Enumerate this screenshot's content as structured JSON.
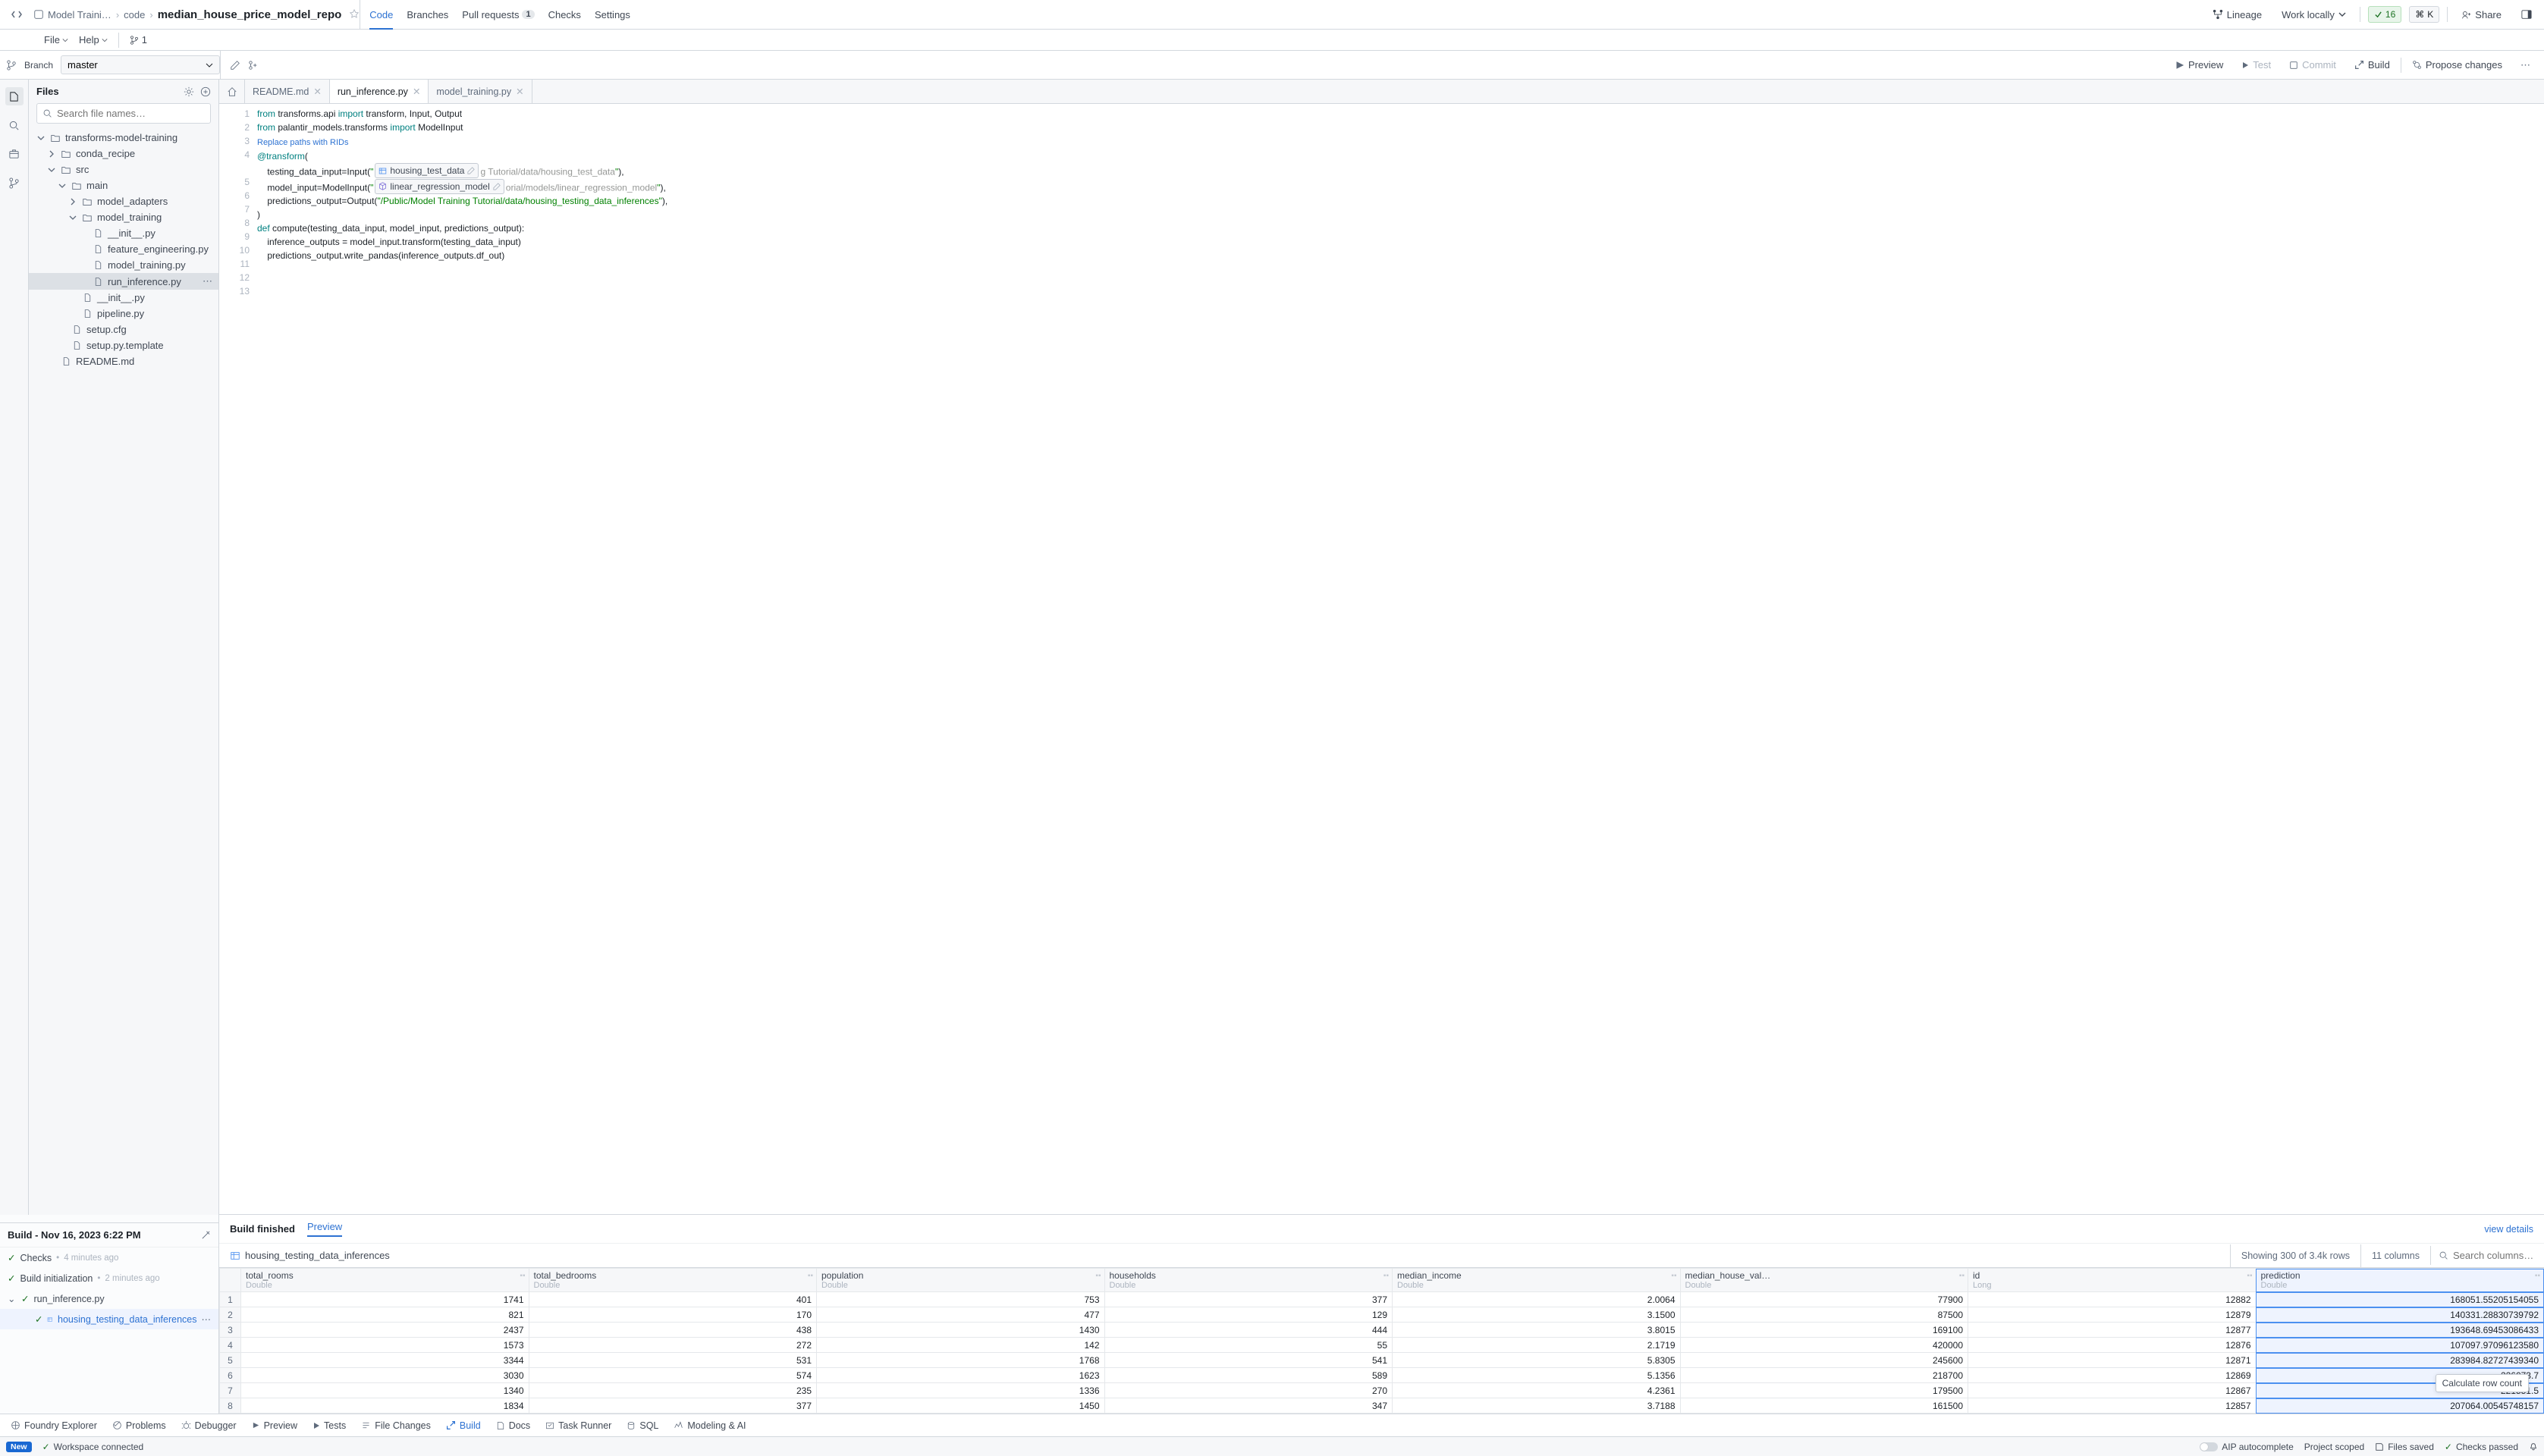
{
  "breadcrumbs": {
    "item1": "Model Traini…",
    "item2": "code",
    "item3": "median_house_price_model_repo"
  },
  "menus": {
    "file": "File",
    "help": "Help",
    "branchCount": "1"
  },
  "toptabs": {
    "code": "Code",
    "branches": "Branches",
    "pr": "Pull requests",
    "prCount": "1",
    "checks": "Checks",
    "settings": "Settings"
  },
  "topright": {
    "lineage": "Lineage",
    "work": "Work locally",
    "pill": "16",
    "k": "K",
    "share": "Share"
  },
  "branch": {
    "label": "Branch",
    "value": "master"
  },
  "actions": {
    "preview": "Preview",
    "test": "Test",
    "commit": "Commit",
    "build": "Build",
    "propose": "Propose changes"
  },
  "files": {
    "title": "Files",
    "searchPlaceholder": "Search file names…",
    "tree": [
      {
        "d": 0,
        "t": "folder",
        "open": true,
        "name": "transforms-model-training"
      },
      {
        "d": 1,
        "t": "folder",
        "open": false,
        "name": "conda_recipe"
      },
      {
        "d": 1,
        "t": "folder",
        "open": true,
        "name": "src"
      },
      {
        "d": 2,
        "t": "folder",
        "open": true,
        "name": "main"
      },
      {
        "d": 3,
        "t": "folder",
        "open": false,
        "name": "model_adapters"
      },
      {
        "d": 3,
        "t": "folder",
        "open": true,
        "name": "model_training"
      },
      {
        "d": 4,
        "t": "file",
        "name": "__init__.py"
      },
      {
        "d": 4,
        "t": "file",
        "name": "feature_engineering.py"
      },
      {
        "d": 4,
        "t": "file",
        "name": "model_training.py"
      },
      {
        "d": 4,
        "t": "file",
        "name": "run_inference.py",
        "sel": true
      },
      {
        "d": 3,
        "t": "file",
        "name": "__init__.py"
      },
      {
        "d": 3,
        "t": "file",
        "name": "pipeline.py"
      },
      {
        "d": 2,
        "t": "file",
        "name": "setup.cfg"
      },
      {
        "d": 2,
        "t": "file",
        "name": "setup.py.template"
      },
      {
        "d": 1,
        "t": "file",
        "name": "README.md"
      }
    ]
  },
  "editor": {
    "tabs": [
      {
        "name": "README.md",
        "active": false
      },
      {
        "name": "run_inference.py",
        "active": true
      },
      {
        "name": "model_training.py",
        "active": false
      }
    ],
    "rid_hint": "Replace paths with RIDs",
    "chip1": "housing_test_data",
    "chip1_ghost": "g Tutorial/data/housing_test_data",
    "chip2": "linear_regression_model",
    "chip2_ghost": "orial/models/linear_regression_model",
    "output_path": "/Public/Model Training Tutorial/data/housing_testing_data_inferences"
  },
  "build": {
    "title_prefix": "Build - ",
    "title_ts": "Nov 16, 2023 6:22 PM",
    "checks": "Checks",
    "checks_ago": "4 minutes ago",
    "init": "Build initialization",
    "init_ago": "2 minutes ago",
    "file": "run_inference.py",
    "dataset": "housing_testing_data_inferences"
  },
  "preview": {
    "status": "Build finished",
    "tab": "Preview",
    "details": "view details",
    "dataset": "housing_testing_data_inferences",
    "rows": "Showing 300 of 3.4k rows",
    "cols": "11 columns",
    "searchPlaceholder": "Search columns…",
    "tooltip": "Calculate row count",
    "columns": [
      {
        "name": "total_rooms",
        "type": "Double"
      },
      {
        "name": "total_bedrooms",
        "type": "Double"
      },
      {
        "name": "population",
        "type": "Double"
      },
      {
        "name": "households",
        "type": "Double"
      },
      {
        "name": "median_income",
        "type": "Double"
      },
      {
        "name": "median_house_val…",
        "type": "Double"
      },
      {
        "name": "id",
        "type": "Long"
      },
      {
        "name": "prediction",
        "type": "Double",
        "hl": true
      }
    ],
    "data": [
      [
        "1741",
        "401",
        "753",
        "377",
        "2.0064",
        "77900",
        "12882",
        "168051.55205154055"
      ],
      [
        "821",
        "170",
        "477",
        "129",
        "3.1500",
        "87500",
        "12879",
        "140331.28830739792"
      ],
      [
        "2437",
        "438",
        "1430",
        "444",
        "3.8015",
        "169100",
        "12877",
        "193648.69453086433"
      ],
      [
        "1573",
        "272",
        "142",
        "55",
        "2.1719",
        "420000",
        "12876",
        "107097.97096123580"
      ],
      [
        "3344",
        "531",
        "1768",
        "541",
        "5.8305",
        "245600",
        "12871",
        "283984.82727439340"
      ],
      [
        "3030",
        "574",
        "1623",
        "589",
        "5.1356",
        "218700",
        "12869",
        "226073.7"
      ],
      [
        "1340",
        "235",
        "1336",
        "270",
        "4.2361",
        "179500",
        "12867",
        "221551.5"
      ],
      [
        "1834",
        "377",
        "1450",
        "347",
        "3.7188",
        "161500",
        "12857",
        "207064.00545748157"
      ]
    ]
  },
  "botbar": {
    "foundry": "Foundry Explorer",
    "problems": "Problems",
    "debugger": "Debugger",
    "preview": "Preview",
    "tests": "Tests",
    "file_changes": "File Changes",
    "build": "Build",
    "docs": "Docs",
    "task": "Task Runner",
    "sql": "SQL",
    "modeling": "Modeling & AI"
  },
  "status": {
    "new": "New",
    "ws": "Workspace connected",
    "aip": "AIP autocomplete",
    "scope": "Project scoped",
    "saved": "Files saved",
    "checks": "Checks passed"
  }
}
